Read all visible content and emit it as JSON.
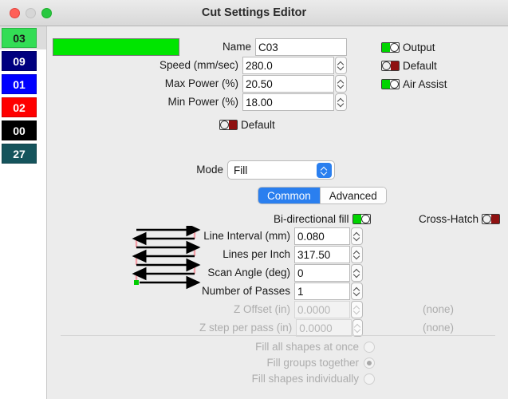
{
  "window": {
    "title": "Cut Settings Editor",
    "controls": {
      "close": "close",
      "minimize": "minimize",
      "zoom": "zoom"
    }
  },
  "sidebar": {
    "layers": [
      {
        "label": "03",
        "color": "#33dd55",
        "text_color": "#1a1a1a",
        "selected": true
      },
      {
        "label": "09",
        "color": "#00007f",
        "text_color": "#ffffff",
        "selected": false
      },
      {
        "label": "01",
        "color": "#0000ff",
        "text_color": "#ffffff",
        "selected": false
      },
      {
        "label": "02",
        "color": "#ff0000",
        "text_color": "#ffffff",
        "selected": false
      },
      {
        "label": "00",
        "color": "#000000",
        "text_color": "#ffffff",
        "selected": false
      },
      {
        "label": "27",
        "color": "#15545c",
        "text_color": "#ffffff",
        "selected": false
      }
    ]
  },
  "main": {
    "layer_color": "#00e500",
    "fields": {
      "name": {
        "label": "Name",
        "value": "C03"
      },
      "speed": {
        "label": "Speed (mm/sec)",
        "value": "280.0"
      },
      "max_power": {
        "label": "Max Power (%)",
        "value": "20.50"
      },
      "min_power": {
        "label": "Min Power (%)",
        "value": "18.00"
      }
    },
    "toggles": {
      "output": {
        "label": "Output",
        "on": true
      },
      "default_hp": {
        "label": "Default",
        "on": false
      },
      "air_assist": {
        "label": "Air Assist",
        "on": true
      },
      "default_layer": {
        "label": "Default",
        "on": false
      }
    },
    "mode": {
      "label": "Mode",
      "value": "Fill"
    },
    "tabs": [
      {
        "label": "Common",
        "active": true
      },
      {
        "label": "Advanced",
        "active": false
      }
    ],
    "fill_toggles": {
      "bidirectional": {
        "label": "Bi-directional fill",
        "on": true
      },
      "cross_hatch": {
        "label": "Cross-Hatch",
        "on": false
      }
    },
    "fill_fields": [
      {
        "label": "Line Interval (mm)",
        "value": "0.080",
        "disabled": false,
        "suffix": ""
      },
      {
        "label": "Lines per Inch",
        "value": "317.50",
        "disabled": false,
        "suffix": ""
      },
      {
        "label": "Scan Angle (deg)",
        "value": "0",
        "disabled": false,
        "suffix": ""
      },
      {
        "label": "Number of Passes",
        "value": "1",
        "disabled": false,
        "suffix": ""
      },
      {
        "label": "Z Offset (in)",
        "value": "0.0000",
        "disabled": true,
        "suffix": "(none)"
      },
      {
        "label": "Z step per pass (in)",
        "value": "0.0000",
        "disabled": true,
        "suffix": "(none)"
      }
    ],
    "fill_mode_options": [
      {
        "label": "Fill all shapes at once",
        "selected": false
      },
      {
        "label": "Fill groups together",
        "selected": true
      },
      {
        "label": "Fill shapes individually",
        "selected": false
      }
    ],
    "diagram": {
      "name": "bidirectional-fill-path",
      "start_marker_color": "#00cc00",
      "connector_color": "#f4a0a8",
      "arrow_color": "#000000",
      "rows": 7
    }
  },
  "colors": {
    "accent": "#2a7fef",
    "toggle_on": "#00d400",
    "toggle_off": "#8f1111"
  }
}
